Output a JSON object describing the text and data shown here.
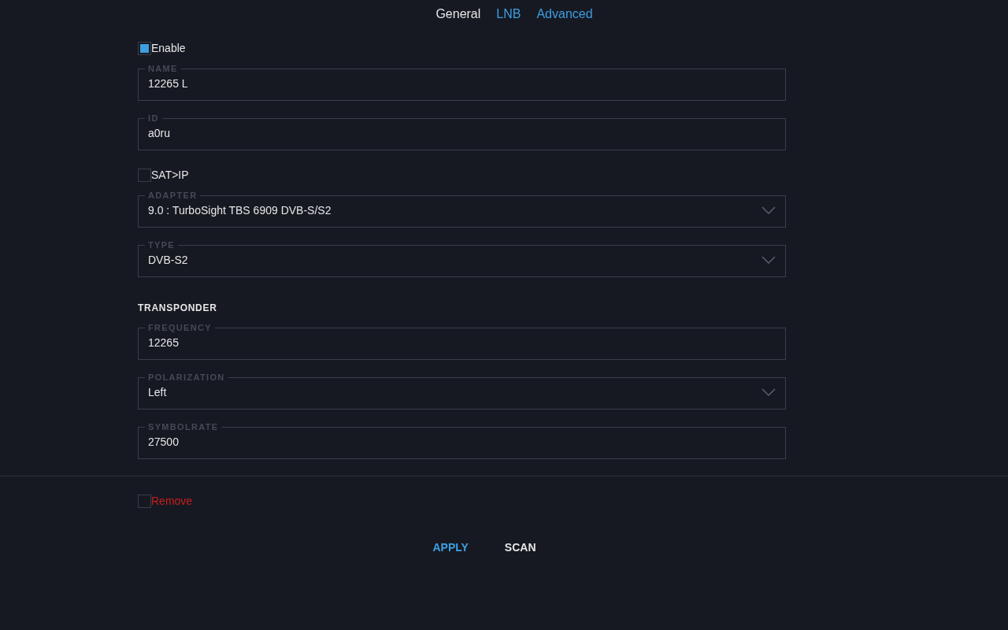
{
  "tabs": [
    {
      "label": "General",
      "selected": true
    },
    {
      "label": "LNB",
      "selected": false
    },
    {
      "label": "Advanced",
      "selected": false
    }
  ],
  "items": [
    {
      "kind": "checkbox",
      "label": "Enable",
      "checked": true
    },
    {
      "kind": "text",
      "label": "NAME",
      "value": "12265 L"
    },
    {
      "kind": "text",
      "label": "ID",
      "value": "a0ru"
    },
    {
      "kind": "checkbox",
      "label": "SAT>IP",
      "checked": false
    },
    {
      "kind": "select",
      "label": "ADAPTER",
      "value": "9.0 : TurboSight TBS 6909 DVB-S/S2"
    },
    {
      "kind": "select",
      "label": "TYPE",
      "value": "DVB-S2"
    },
    {
      "kind": "heading",
      "label": "TRANSPONDER"
    },
    {
      "kind": "text",
      "label": "FREQUENCY",
      "value": "12265"
    },
    {
      "kind": "select",
      "label": "POLARIZATION",
      "value": "Left"
    },
    {
      "kind": "text",
      "label": "SYMBOLRATE",
      "value": "27500"
    }
  ],
  "remove": {
    "label": "Remove",
    "checked": false
  },
  "buttons": [
    {
      "label": "APPLY",
      "kind": "primary"
    },
    {
      "label": "SCAN",
      "kind": "secondary"
    }
  ]
}
